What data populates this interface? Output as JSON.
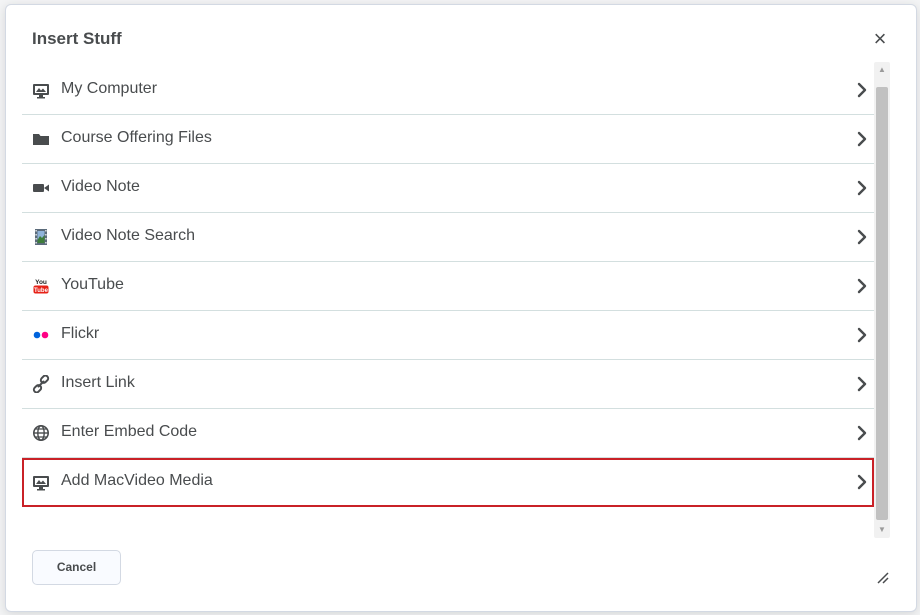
{
  "dialog": {
    "title": "Insert Stuff",
    "close_glyph": "×",
    "cancel_label": "Cancel"
  },
  "items": [
    {
      "label": "My Computer",
      "icon": "computer-icon"
    },
    {
      "label": "Course Offering Files",
      "icon": "folder-icon"
    },
    {
      "label": "Video Note",
      "icon": "video-camera-icon"
    },
    {
      "label": "Video Note Search",
      "icon": "film-icon"
    },
    {
      "label": "YouTube",
      "icon": "youtube-icon"
    },
    {
      "label": "Flickr",
      "icon": "flickr-icon"
    },
    {
      "label": "Insert Link",
      "icon": "link-icon"
    },
    {
      "label": "Enter Embed Code",
      "icon": "globe-icon"
    },
    {
      "label": "Add MacVideo Media",
      "icon": "computer-icon",
      "highlighted": true
    }
  ],
  "colors": {
    "text": "#494c4e",
    "highlight": "#c92127",
    "divider": "#d3dfdf",
    "youtube": "#e62117",
    "flickr_blue": "#0063dc",
    "flickr_pink": "#ff0084"
  }
}
